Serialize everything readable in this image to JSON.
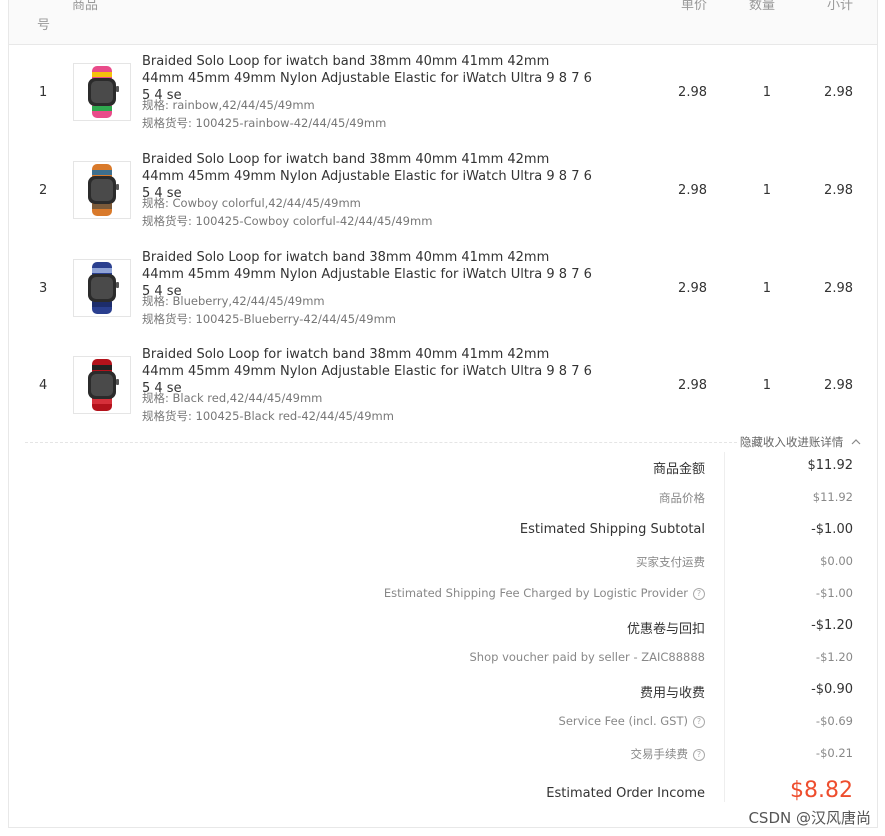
{
  "header": {
    "col_no": "号",
    "col_product": "商品",
    "col_price": "单价",
    "col_qty": "数量",
    "col_subtotal": "小计"
  },
  "items": [
    {
      "index": "1",
      "title": "Braided Solo Loop for iwatch band 38mm 40mm 41mm 42mm 44mm 45mm 49mm Nylon Adjustable Elastic for iWatch Ultra 9 8 7 6 5 4 se",
      "spec": "规格: rainbow,42/44/45/49mm",
      "sku": "规格货号: 100425-rainbow-42/44/45/49mm",
      "price": "2.98",
      "qty": "1",
      "subtotal": "2.98",
      "band_color_a": "#e94b8a",
      "band_color_b": "#f4c20d",
      "band_color_c": "#2fa84f"
    },
    {
      "index": "2",
      "title": "Braided Solo Loop for iwatch band 38mm 40mm 41mm 42mm 44mm 45mm 49mm Nylon Adjustable Elastic for iWatch Ultra 9 8 7 6 5 4 se",
      "spec": "规格: Cowboy colorful,42/44/45/49mm",
      "sku": "规格货号: 100425-Cowboy colorful-42/44/45/49mm",
      "price": "2.98",
      "qty": "1",
      "subtotal": "2.98",
      "band_color_a": "#d97a2b",
      "band_color_b": "#3d6f8e",
      "band_color_c": "#7a5a3a"
    },
    {
      "index": "3",
      "title": "Braided Solo Loop for iwatch band 38mm 40mm 41mm 42mm 44mm 45mm 49mm Nylon Adjustable Elastic for iWatch Ultra 9 8 7 6 5 4 se",
      "spec": "规格: Blueberry,42/44/45/49mm",
      "sku": "规格货号: 100425-Blueberry-42/44/45/49mm",
      "price": "2.98",
      "qty": "1",
      "subtotal": "2.98",
      "band_color_a": "#2a3f8f",
      "band_color_b": "#8fa3d6",
      "band_color_c": "#1d2d6b"
    },
    {
      "index": "4",
      "title": "Braided Solo Loop for iwatch band 38mm 40mm 41mm 42mm 44mm 45mm 49mm Nylon Adjustable Elastic for iWatch Ultra 9 8 7 6 5 4 se",
      "spec": "规格: Black red,42/44/45/49mm",
      "sku": "规格货号: 100425-Black red-42/44/45/49mm",
      "price": "2.98",
      "qty": "1",
      "subtotal": "2.98",
      "band_color_a": "#b3121b",
      "band_color_b": "#222222",
      "band_color_c": "#d6303a"
    }
  ],
  "summary": {
    "toggle_label": "隐藏收入收进账详情",
    "rows": [
      {
        "label": "商品金额",
        "value": "$11.92",
        "level": 1,
        "info": false
      },
      {
        "label": "商品价格",
        "value": "$11.92",
        "level": 2,
        "info": false
      },
      {
        "label": "Estimated Shipping Subtotal",
        "value": "-$1.00",
        "level": 1,
        "info": false
      },
      {
        "label": "买家支付运费",
        "value": "$0.00",
        "level": 2,
        "info": false
      },
      {
        "label": "Estimated Shipping Fee Charged by Logistic Provider",
        "value": "-$1.00",
        "level": 2,
        "info": true
      },
      {
        "label": "优惠卷与回扣",
        "value": "-$1.20",
        "level": 1,
        "info": false
      },
      {
        "label": "Shop voucher paid by seller - ZAIC88888",
        "value": "-$1.20",
        "level": 2,
        "info": false
      },
      {
        "label": "费用与收费",
        "value": "-$0.90",
        "level": 1,
        "info": false
      },
      {
        "label": "Service Fee (incl. GST)",
        "value": "-$0.69",
        "level": 2,
        "info": true
      },
      {
        "label": "交易手续费",
        "value": "-$0.21",
        "level": 2,
        "info": true
      }
    ],
    "total_label": "Estimated Order Income",
    "total_value": "$8.82",
    "accent_color": "#ee4d2d"
  },
  "watermark": "CSDN @汉风唐尚"
}
